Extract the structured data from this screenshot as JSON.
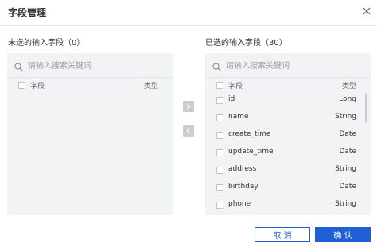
{
  "dialog": {
    "title": "字段管理",
    "close_icon": "close-icon"
  },
  "left_panel": {
    "label": "未选的输入字段（0）",
    "search_placeholder": "请输入搜索关键词",
    "header": {
      "name": "字段",
      "type": "类型"
    },
    "rows": []
  },
  "right_panel": {
    "label": "已选的输入字段（30）",
    "search_placeholder": "请输入搜索关键词",
    "header": {
      "name": "字段",
      "type": "类型"
    },
    "rows": [
      {
        "name": "id",
        "type": "Long"
      },
      {
        "name": "name",
        "type": "String"
      },
      {
        "name": "create_time",
        "type": "Date"
      },
      {
        "name": "update_time",
        "type": "Date"
      },
      {
        "name": "address",
        "type": "String"
      },
      {
        "name": "birthday",
        "type": "Date"
      },
      {
        "name": "phone",
        "type": "String"
      }
    ]
  },
  "transfer": {
    "move_right_icon": "chevron-right-icon",
    "move_left_icon": "chevron-left-icon"
  },
  "footer": {
    "cancel_label": "取 消",
    "ok_label": "确 认"
  },
  "colors": {
    "primary": "#1f5fd3",
    "panel_bg": "#f2f3f5",
    "transfer_button": "#c9cdd3"
  }
}
